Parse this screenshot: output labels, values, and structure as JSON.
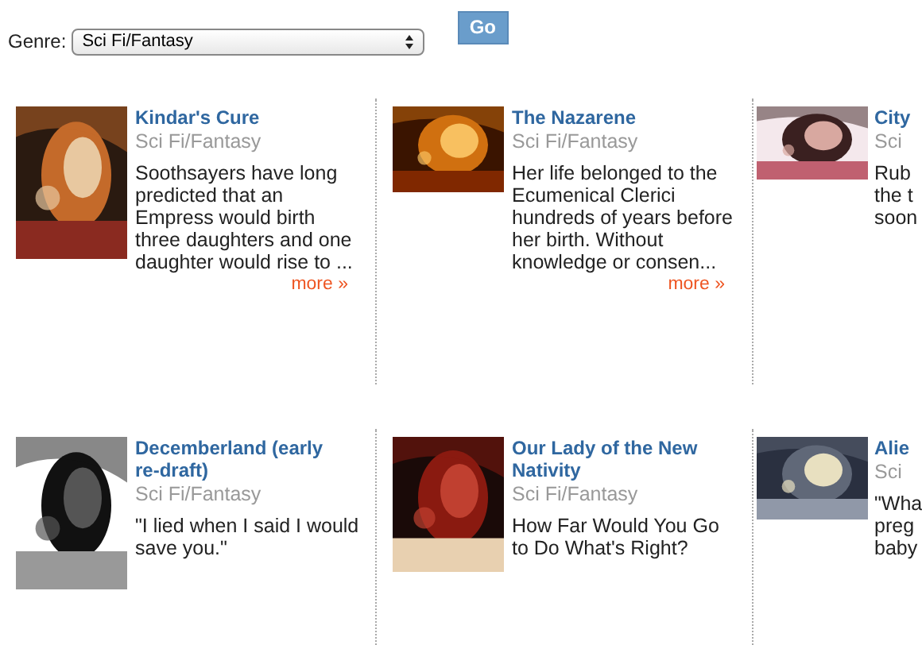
{
  "filter": {
    "label": "Genre:",
    "genre_select": {
      "value": "Sci Fi/Fantasy"
    },
    "go_button": "Go"
  },
  "book_rows": [
    {
      "books": [
        {
          "title_lines": [
            "Kindar's Cure"
          ],
          "genre": "Sci Fi/Fantasy",
          "description_lines": [
            "Soothsayers have long",
            "predicted that an",
            "Empress would birth",
            "three daughters and one",
            "daughter would rise to ..."
          ],
          "more_link": "more »"
        },
        {
          "title_lines": [
            "The Nazarene"
          ],
          "genre": "Sci Fi/Fantasy",
          "description_lines": [
            "Her life belonged to the",
            "Ecumenical Clerici",
            "hundreds of years before",
            "her birth.  Without",
            "knowledge or consen..."
          ],
          "more_link": "more »"
        },
        {
          "title_lines": [
            "City"
          ],
          "genre": "Sci",
          "description_lines": [
            "Rub",
            "the t",
            "soon"
          ]
        }
      ]
    },
    {
      "books": [
        {
          "title_lines": [
            "Decemberland  (early",
            "re-draft)"
          ],
          "genre": "Sci Fi/Fantasy",
          "description_lines": [
            "\"I lied when I said I would",
            "save you.\""
          ]
        },
        {
          "title_lines": [
            "Our Lady of the New",
            "Nativity"
          ],
          "genre": "Sci Fi/Fantasy",
          "description_lines": [
            "How Far Would You Go",
            "to Do What's Right?"
          ]
        },
        {
          "title_lines": [
            "Alie"
          ],
          "genre": "Sci",
          "description_lines": [
            "\"Wha",
            "preg",
            "baby"
          ]
        }
      ]
    }
  ]
}
